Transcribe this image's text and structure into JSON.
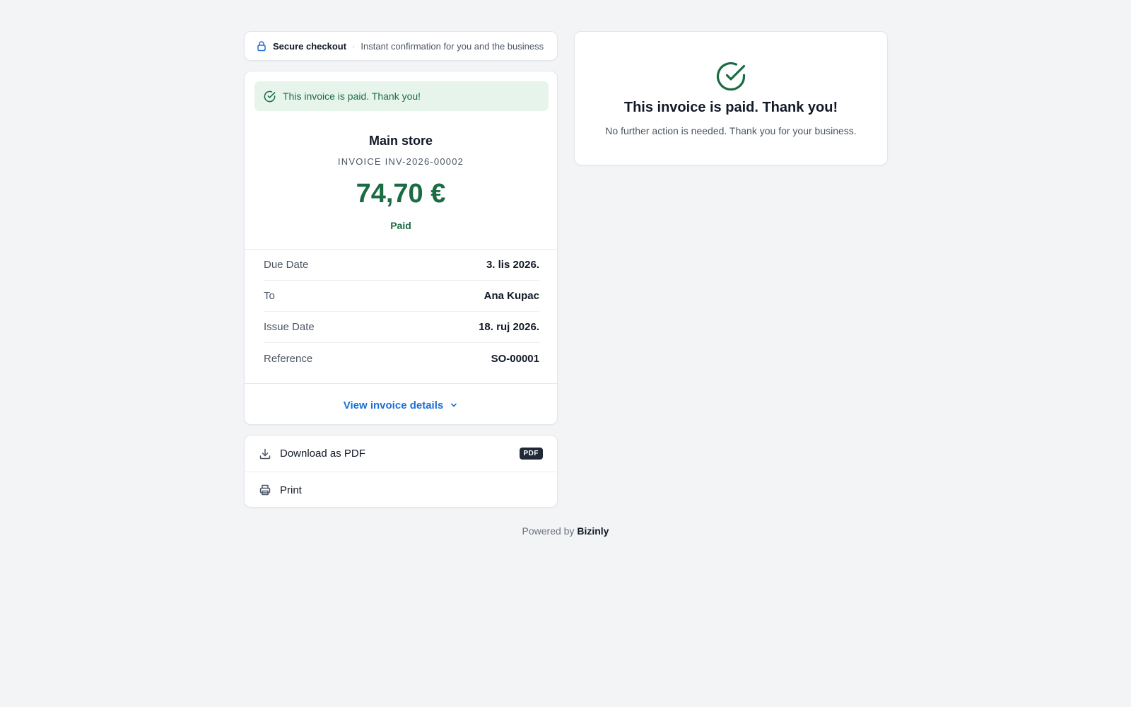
{
  "secure_bar": {
    "title": "Secure checkout",
    "separator": "·",
    "subtitle": "Instant confirmation for you and the business",
    "icon": "lock-icon"
  },
  "invoice": {
    "paid_banner": "This invoice is paid. Thank you!",
    "store": "Main store",
    "number": "INVOICE INV-2026-00002",
    "amount": "74,70 €",
    "status": "Paid",
    "rows": [
      {
        "label": "Due Date",
        "value": "3. lis 2026."
      },
      {
        "label": "To",
        "value": "Ana Kupac"
      },
      {
        "label": "Issue Date",
        "value": "18. ruj 2026."
      },
      {
        "label": "Reference",
        "value": "SO-00001"
      }
    ],
    "details_link": "View invoice details"
  },
  "actions": {
    "download_label": "Download as PDF",
    "download_badge": "PDF",
    "print_label": "Print"
  },
  "confirmation": {
    "title": "This invoice is paid. Thank you!",
    "subtitle": "No further action is needed. Thank you for your business."
  },
  "footer": {
    "powered_by": "Powered by",
    "brand": "Bizinly"
  },
  "colors": {
    "success": "#1b6b43",
    "success_bg": "#e6f4ec",
    "link": "#1d6fd6",
    "page_bg": "#f3f4f6"
  }
}
